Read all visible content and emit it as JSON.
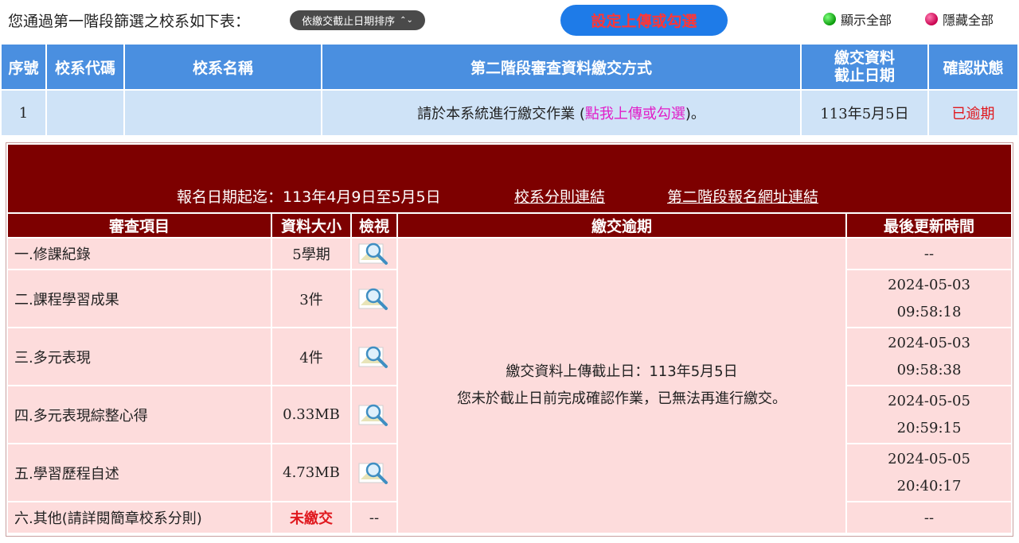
{
  "top": {
    "intro": "您通過第一階段篩選之校系如下表：",
    "sort_label": "依繳交截止日期排序",
    "set_button": "設定上傳或勾選",
    "show_all": "顯示全部",
    "hide_all": "隱藏全部"
  },
  "main_table": {
    "headers": [
      "序號",
      "校系代碼",
      "校系名稱",
      "第二階段審查資料繳交方式",
      "繳交資料截止日期",
      "確認狀態"
    ],
    "row": {
      "index": "1",
      "code": "",
      "name": "",
      "method_prefix": "請於本系統進行繳交作業 (",
      "method_link": "點我上傳或勾選",
      "method_suffix": ")。",
      "deadline": "113年5月5日",
      "status": "已逾期"
    }
  },
  "panel": {
    "reg_date": "報名日期起迄：113年4月9日至5月5日",
    "link_rules": "校系分則連結",
    "link_stage2": "第二階段報名網址連結",
    "headers": [
      "審查項目",
      "資料大小",
      "檢視",
      "繳交逾期",
      "最後更新時間"
    ],
    "rows": [
      {
        "item": "一.修課紀錄",
        "size": "5學期",
        "updated_date": "--",
        "updated_time": ""
      },
      {
        "item": "二.課程學習成果",
        "size": "3件",
        "updated_date": "2024-05-03",
        "updated_time": "09:58:18"
      },
      {
        "item": "三.多元表現",
        "size": "4件",
        "updated_date": "2024-05-03",
        "updated_time": "09:58:38"
      },
      {
        "item": "四.多元表現綜整心得",
        "size": "0.33MB",
        "updated_date": "2024-05-05",
        "updated_time": "20:59:15"
      },
      {
        "item": "五.學習歷程自述",
        "size": "4.73MB",
        "updated_date": "2024-05-05",
        "updated_time": "20:40:17"
      },
      {
        "item": "六.其他(請詳閱簡章校系分則)",
        "size": "未繳交",
        "view": "--",
        "updated_date": "--",
        "updated_time": ""
      }
    ],
    "notice_line1": "繳交資料上傳截止日：113年5月5日",
    "notice_line2": "您未於截止日前完成確認作業，已無法再進行繳交。"
  },
  "colors": {
    "header_blue": "#4a8fe0",
    "row_blue": "#cfe3f7",
    "panel_red": "#7d0000",
    "cell_pink": "#fddcdc",
    "alert_red": "#e0181e",
    "link_pink": "#e11ec8"
  },
  "icons": [
    "chevron-updown-icon",
    "green-dot-icon",
    "red-dot-icon",
    "magnifier-icon"
  ]
}
